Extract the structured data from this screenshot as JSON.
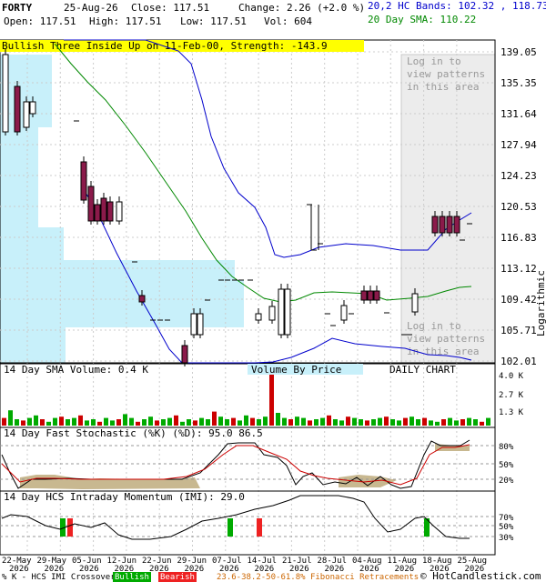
{
  "header": {
    "symbol": "FORTY",
    "date": "25-Aug-26",
    "close": "Close: 117.51",
    "change": "Change: 2.26 (+2.0 %)",
    "open": "Open: 117.51",
    "high": "High: 117.51",
    "low": "Low: 117.51",
    "vol": "Vol: 604",
    "bands": "20,2 HC Bands: 102.32 , 118.73",
    "sma": "20 Day SMA: 110.22"
  },
  "pattern_banner": "Bullish Three Inside Up on 11-Feb-00, Strength: -143.9",
  "login_text": "Log in to view patterns in this area",
  "scale_label": "Logarithmic",
  "colors": {
    "bull": "#ffffff",
    "bear": "#8b1a4a",
    "band": "#0000cc",
    "sma": "#008800",
    "vbp": "#c8f0fa",
    "vol_up": "#00aa00",
    "vol_down": "#cc0000",
    "stoch_k": "#000000",
    "stoch_d": "#cc0000",
    "fill": "#c8b890"
  },
  "chart_data": {
    "type": "line",
    "price_ticks": [
      "139.05",
      "135.35",
      "131.64",
      "127.94",
      "124.23",
      "120.53",
      "116.83",
      "113.12",
      "109.42",
      "105.71",
      "102.01"
    ],
    "x_labels": [
      {
        "l1": "22-May",
        "l2": "2026"
      },
      {
        "l1": "29-May",
        "l2": "2026"
      },
      {
        "l1": "05-Jun",
        "l2": "2026"
      },
      {
        "l1": "12-Jun",
        "l2": "2026"
      },
      {
        "l1": "22-Jun",
        "l2": "2026"
      },
      {
        "l1": "29-Jun",
        "l2": "2026"
      },
      {
        "l1": "07-Jul",
        "l2": "2026"
      },
      {
        "l1": "14-Jul",
        "l2": "2026"
      },
      {
        "l1": "21-Jul",
        "l2": "2026"
      },
      {
        "l1": "28-Jul",
        "l2": "2026"
      },
      {
        "l1": "04-Aug",
        "l2": "2026"
      },
      {
        "l1": "11-Aug",
        "l2": "2026"
      },
      {
        "l1": "18-Aug",
        "l2": "2026"
      },
      {
        "l1": "25-Aug",
        "l2": "2026"
      }
    ],
    "volume_title": "14 Day SMA Volume: 0.4 K",
    "vbp_title": "Volume By Price",
    "daily_title": "DAILY CHART",
    "volume_ticks": [
      "4.0 K",
      "2.7 K",
      "1.3 K"
    ],
    "stoch_title": "14 Day Fast Stochastic (%K) (%D): 95.0  86.5",
    "stoch_ticks": [
      "80%",
      "50%",
      "20%"
    ],
    "imi_title": "14 Day HCS Intraday Momentum (IMI): 29.0",
    "imi_ticks": [
      "70%",
      "50%",
      "30%"
    ],
    "volume": [
      0.6,
      1.2,
      0.5,
      0.4,
      0.6,
      0.8,
      0.5,
      0.3,
      0.6,
      0.7,
      0.5,
      0.6,
      0.8,
      0.4,
      0.5,
      0.3,
      0.6,
      0.4,
      0.5,
      0.9,
      0.6,
      0.3,
      0.5,
      0.7,
      0.4,
      0.5,
      0.6,
      0.8,
      0.3,
      0.5,
      0.4,
      0.6,
      0.5,
      1.1,
      0.7,
      0.5,
      0.6,
      0.4,
      0.8,
      0.6,
      0.5,
      0.7,
      4.0,
      1.0,
      0.6,
      0.5,
      0.7,
      0.6,
      0.4,
      0.5,
      0.6,
      0.8,
      0.5,
      0.4,
      0.7,
      0.6,
      0.5,
      0.4,
      0.5,
      0.6,
      0.7,
      0.5,
      0.4,
      0.6,
      0.7,
      0.5,
      0.6,
      0.4,
      0.3,
      0.5,
      0.6,
      0.4,
      0.5,
      0.6,
      0.5,
      0.3,
      0.6
    ]
  },
  "footer": {
    "crossover": "% K - HCS IMI Crossover,",
    "bullish": "Bullish",
    "bearish": "Bearish",
    "fib": "23.6-38.2-50-61.8% Fibonacci Retracements",
    "copyright": "© HotCandlestick.com"
  }
}
